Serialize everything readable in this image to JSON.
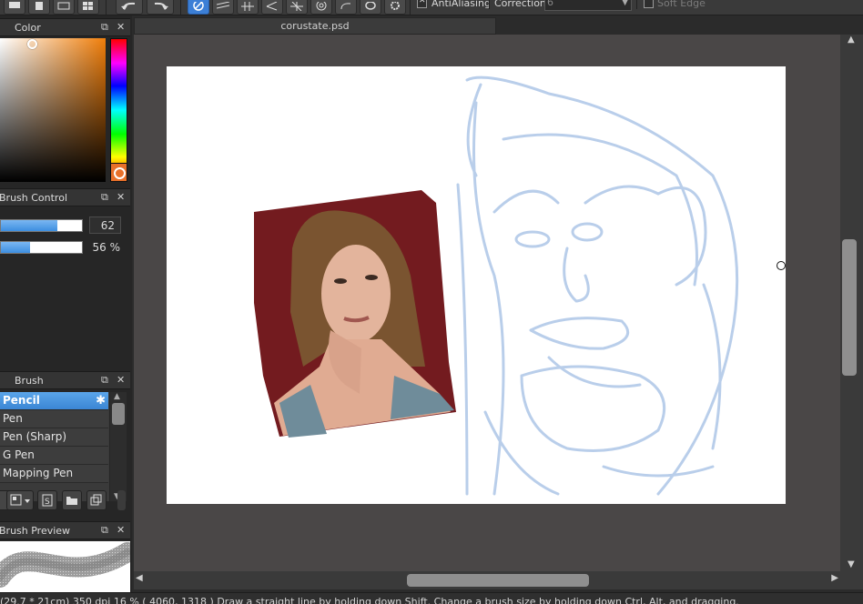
{
  "toolbar": {
    "antialiasing_label": "AntiAliasing",
    "antialiasing_checked": true,
    "correction_label": "Correction",
    "correction_value": "6",
    "softedge_label": "Soft Edge",
    "softedge_checked": false
  },
  "color_panel": {
    "title": "Color",
    "current_hue": "#f07e0a"
  },
  "brush_control": {
    "title": "Brush Control",
    "size_value": "62",
    "density_value": "56 %"
  },
  "brush_panel": {
    "title": "Brush",
    "items": [
      {
        "label": "Pencil"
      },
      {
        "label": "Pen"
      },
      {
        "label": "Pen (Sharp)"
      },
      {
        "label": "G Pen"
      },
      {
        "label": "Mapping Pen"
      }
    ]
  },
  "brush_preview": {
    "title": "Brush Preview"
  },
  "document": {
    "tab_title": "corustate.psd"
  },
  "statusbar": {
    "text": "(29.7 * 21cm)   350 dpi   16 %   ( 4060, 1318 )   Draw a straight line by holding down Shift. Change a brush size by holding down Ctrl, Alt, and dragging."
  }
}
